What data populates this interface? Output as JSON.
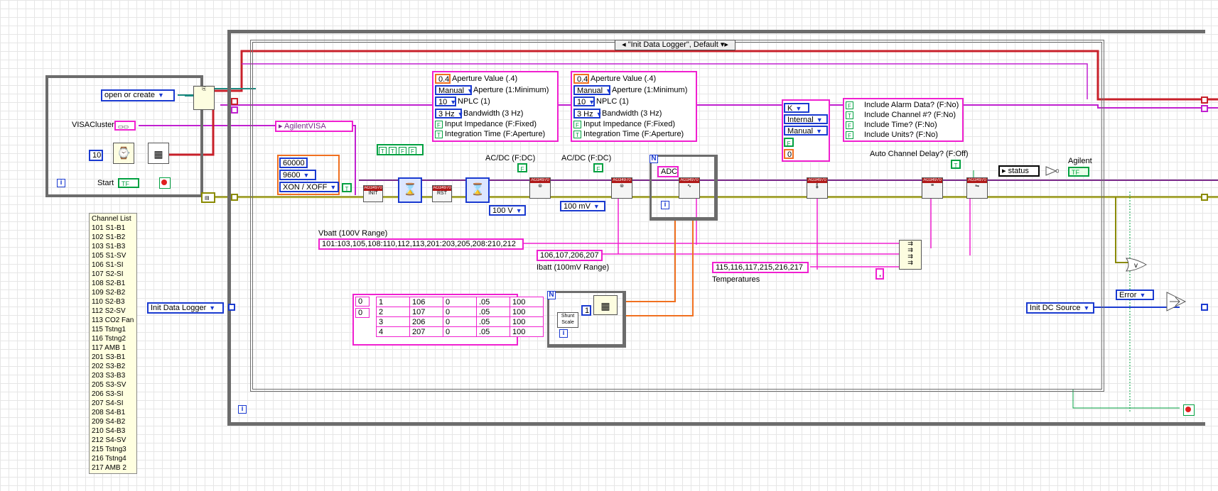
{
  "case_selector": "\"Init Data Logger\", Default",
  "left_panel": {
    "file_mode": "open or create",
    "visa_cluster_label": "VISACluster",
    "timeout_value": "10",
    "start_label": "Start",
    "start_tf": "TF"
  },
  "channel_list": {
    "title": "Channel List",
    "items": [
      "101 S1-B1",
      "102 S1-B2",
      "103 S1-B3",
      "105 S1-SV",
      "106 S1-SI",
      "107 S2-SI",
      "108 S2-B1",
      "109 S2-B2",
      "110 S2-B3",
      "112 S2-SV",
      "113 CO2 Fan",
      "115 Tstng1",
      "116 Tstng2",
      "117 AMB 1",
      "201 S3-B1",
      "202 S3-B2",
      "203 S3-B3",
      "205 S3-SV",
      "206 S3-SI",
      "207 S4-SI",
      "208 S4-B1",
      "209 S4-B2",
      "210 S4-B3",
      "212 S4-SV",
      "215 Tstng3",
      "216 Tstng4",
      "217 AMB 2"
    ]
  },
  "init_data_logger_ctl": "Init Data Logger",
  "agilent_visa": "AgilentVISA",
  "serial": {
    "baud_a": "60000",
    "baud_b": "9600",
    "flow": "XON / XOFF"
  },
  "bool_array": [
    "T",
    "T",
    "F",
    "F"
  ],
  "aperture_block_1": {
    "value": "0.4",
    "value_label": "Aperture Value (.4)",
    "mode": "Manual",
    "mode_label": "Aperture (1:Minimum)",
    "nplc": "10",
    "nplc_label": "NPLC (1)",
    "bw": "3 Hz",
    "bw_label": "Bandwidth (3 Hz)",
    "impedance_label": "Input Impedance (F:Fixed)",
    "integration_label": "Integration Time (F:Aperture)"
  },
  "aperture_block_2": {
    "value": "0.4",
    "value_label": "Aperture Value (.4)",
    "mode": "Manual",
    "mode_label": "Aperture (1:Minimum)",
    "nplc": "10",
    "nplc_label": "NPLC (1)",
    "bw": "3 Hz",
    "bw_label": "Bandwidth (3 Hz)",
    "impedance_label": "Input Impedance (F:Fixed)",
    "integration_label": "Integration Time (F:Aperture)"
  },
  "acdc_1": "AC/DC (F:DC)",
  "acdc_2": "AC/DC (F:DC)",
  "range_1": "100 V",
  "range_2": "100 mV",
  "adc_label": "ADC",
  "thermo": {
    "type": "K",
    "ref": "Internal",
    "mode": "Manual",
    "value": "0"
  },
  "include_opts": [
    "Include Alarm Data? (F:No)",
    "Include Channel #? (F:No)",
    "Include Time? (F:No)",
    "Include Units? (F:No)"
  ],
  "include_vals": [
    "F",
    "T",
    "F",
    "F"
  ],
  "auto_delay_label": "Auto Channel Delay? (F:Off)",
  "status_label": "status",
  "agilent_label": "Agilent",
  "agilent_tf": "TF",
  "vbatt_label": "Vbatt (100V Range)",
  "vbatt_channels": "101:103,105,108:110,112,113,201:203,205,208:210,212",
  "ibatt_channels": "106,107,206,207",
  "ibatt_label": "Ibatt (100mV Range)",
  "temp_channels": "115,116,117,215,216,217",
  "temp_label": "Temperatures",
  "comma": ",",
  "shunt_table": {
    "index": [
      "0",
      "0"
    ],
    "rows": [
      [
        "1",
        "106",
        "0",
        ".05",
        "100"
      ],
      [
        "2",
        "107",
        "0",
        ".05",
        "100"
      ],
      [
        "3",
        "206",
        "0",
        ".05",
        "100"
      ],
      [
        "4",
        "207",
        "0",
        ".05",
        "100"
      ]
    ]
  },
  "shunt_scale_label": "Shunt Scale",
  "loop_count": "1",
  "error_label": "Error",
  "init_dc_source": "Init DC Source"
}
